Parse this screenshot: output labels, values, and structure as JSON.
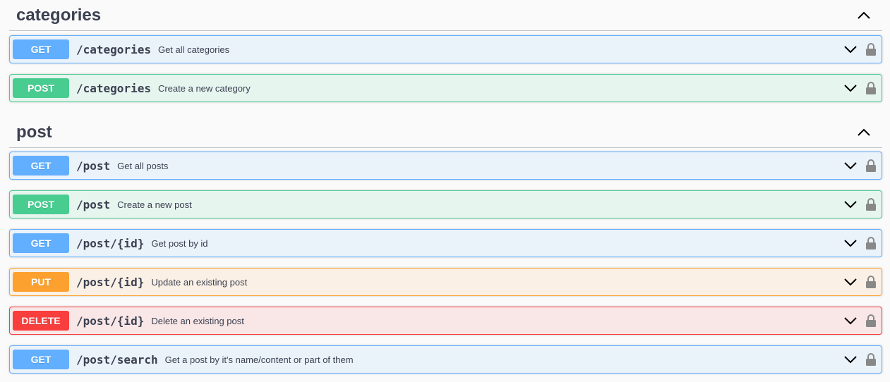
{
  "sections": [
    {
      "title": "categories",
      "operations": [
        {
          "method": "GET",
          "path": "/categories",
          "summary": "Get all categories"
        },
        {
          "method": "POST",
          "path": "/categories",
          "summary": "Create a new category"
        }
      ]
    },
    {
      "title": "post",
      "operations": [
        {
          "method": "GET",
          "path": "/post",
          "summary": "Get all posts"
        },
        {
          "method": "POST",
          "path": "/post",
          "summary": "Create a new post"
        },
        {
          "method": "GET",
          "path": "/post/{id}",
          "summary": "Get post by id"
        },
        {
          "method": "PUT",
          "path": "/post/{id}",
          "summary": "Update an existing post"
        },
        {
          "method": "DELETE",
          "path": "/post/{id}",
          "summary": "Delete an existing post"
        },
        {
          "method": "GET",
          "path": "/post/search",
          "summary": "Get a post by it's name/content or part of them"
        }
      ]
    }
  ],
  "icons": {
    "section_toggle": "chevron-up-icon",
    "operation_expand": "chevron-down-icon",
    "operation_auth": "lock-icon"
  },
  "colors": {
    "get": "#61affe",
    "post": "#49cc90",
    "put": "#fca130",
    "delete": "#f93e3e",
    "text": "#3b4151"
  }
}
